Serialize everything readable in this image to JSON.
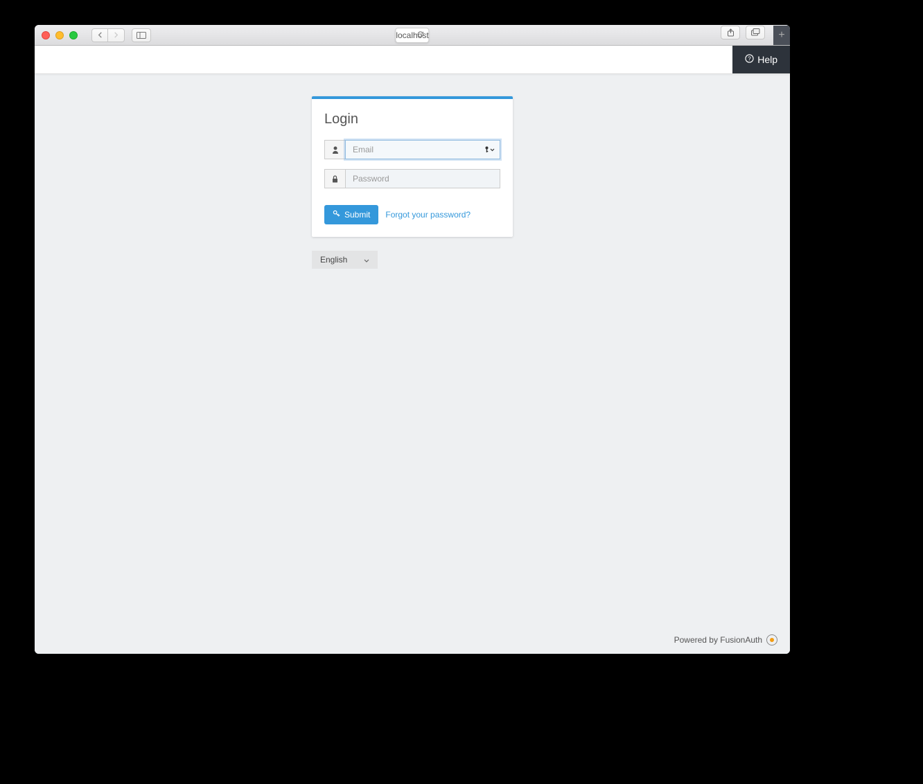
{
  "browser": {
    "url": "localhost"
  },
  "topbar": {
    "help_label": "Help"
  },
  "login": {
    "title": "Login",
    "email_placeholder": "Email",
    "email_value": "",
    "password_placeholder": "Password",
    "password_value": "",
    "submit_label": "Submit",
    "forgot_label": "Forgot your password?"
  },
  "language": {
    "selected": "English"
  },
  "footer": {
    "powered_by": "Powered by FusionAuth"
  }
}
